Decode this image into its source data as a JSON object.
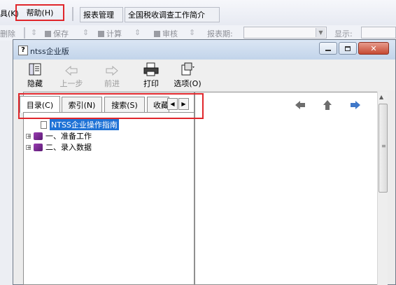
{
  "host": {
    "menu_partial": "具(K)",
    "menu_help": "帮助(H)",
    "tabs": [
      "报表管理",
      "全国税收调查工作简介"
    ],
    "toolbar": {
      "delete": "删除",
      "save": "保存",
      "calculate": "计算",
      "audit": "审核",
      "report_period_label": "报表期:",
      "display_label": "显示:"
    }
  },
  "help_window": {
    "title": "ntss企业版",
    "icon_letter": "?",
    "toolbar": {
      "hide": "隐藏",
      "back": "上一步",
      "forward": "前进",
      "print": "打印",
      "options": "选项(O)"
    },
    "tabs": [
      "目录(C)",
      "索引(N)",
      "搜索(S)",
      "收藏"
    ],
    "tree": [
      {
        "label": "NTSS企业操作指南",
        "type": "page",
        "selected": true
      },
      {
        "label": "一、准备工作",
        "type": "book",
        "expander": "+"
      },
      {
        "label": "二、录入数据",
        "type": "book",
        "expander": "+"
      }
    ]
  },
  "colors": {
    "highlight_box": "#e0262b",
    "selection": "#1e72d6",
    "book_icon": "#7a2a96"
  }
}
